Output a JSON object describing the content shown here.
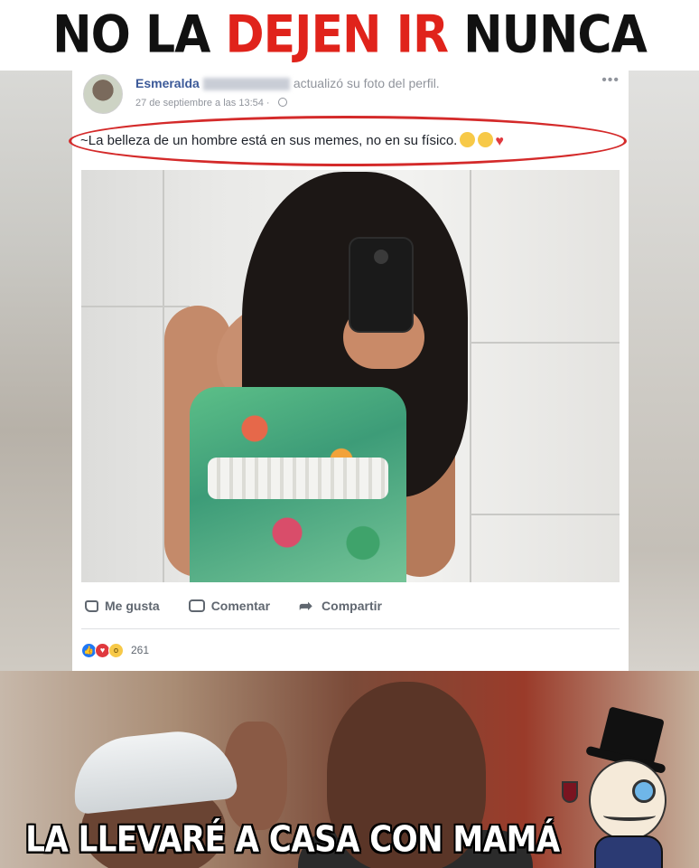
{
  "meme": {
    "top_caption_part1": "NO LA ",
    "top_caption_part2": "DEJEN IR",
    "top_caption_part3": " NUNCA",
    "bottom_caption": "LA LLEVARÉ A CASA CON MAMÁ"
  },
  "post": {
    "author_name": "Esmeralda",
    "action_text": "actualizó su foto del perfil.",
    "timestamp": "27 de septiembre a las 13:54 · ",
    "more_icon": "more-options-icon",
    "text": "~La belleza de un hombre está en sus memes, no en su físico.",
    "highlight_color": "#d42a2a"
  },
  "actions": {
    "like_label": "Me gusta",
    "comment_label": "Comentar",
    "share_label": "Compartir"
  },
  "reactions": {
    "types": [
      "like",
      "love",
      "wow"
    ],
    "count": "261"
  },
  "colors": {
    "caption_red": "#e0231b",
    "fb_blue": "#3b5998",
    "muted_gray": "#90949c"
  }
}
